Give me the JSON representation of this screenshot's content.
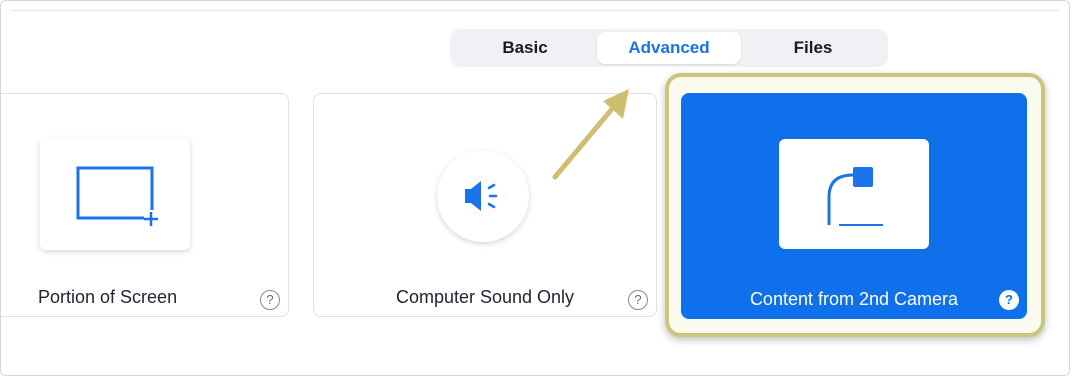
{
  "tabs": [
    {
      "label": "Basic",
      "active": false
    },
    {
      "label": "Advanced",
      "active": true
    },
    {
      "label": "Files",
      "active": false
    }
  ],
  "options": [
    {
      "label": "Portion of Screen",
      "icon": "region-select-icon",
      "selected": false
    },
    {
      "label": "Computer Sound Only",
      "icon": "speaker-icon",
      "selected": false
    },
    {
      "label": "Content from 2nd Camera",
      "icon": "document-camera-icon",
      "selected": true
    }
  ],
  "help_symbol": "?",
  "colors": {
    "accent": "#0e71eb",
    "highlight_border": "#c9c77f",
    "arrow": "#cdbf6f"
  }
}
